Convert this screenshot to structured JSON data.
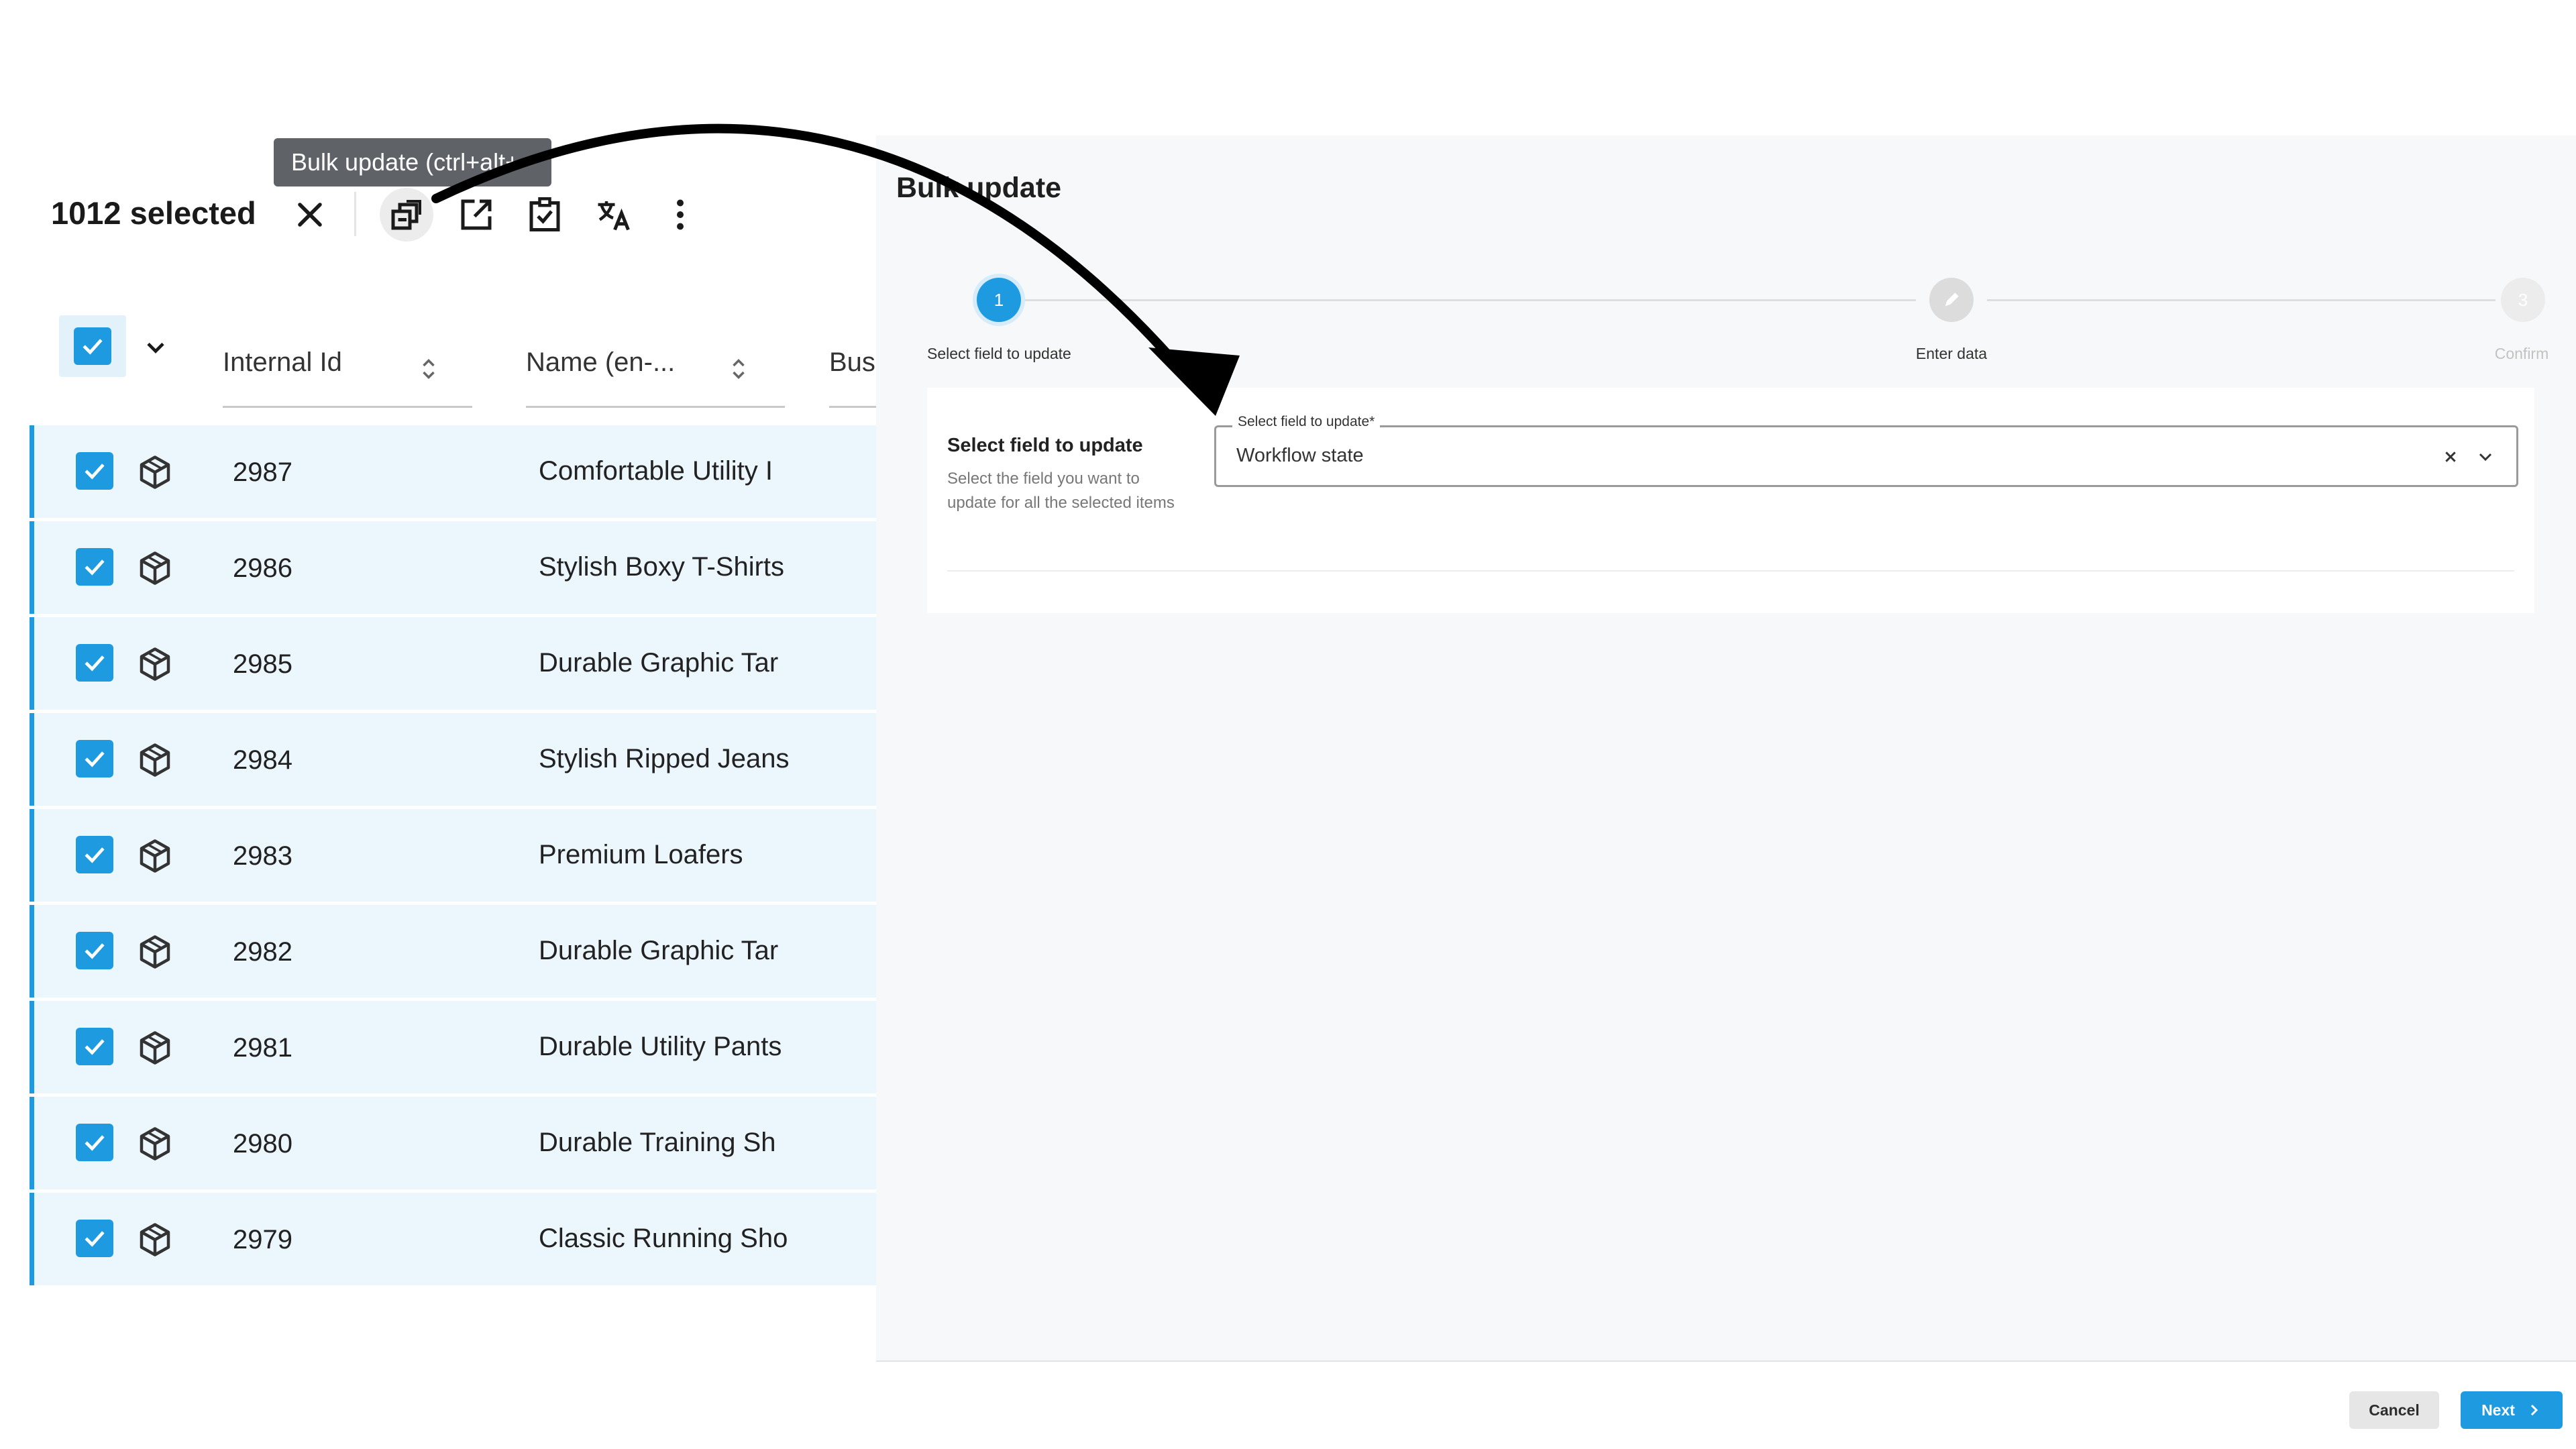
{
  "selection_toolbar": {
    "count_label": "1012 selected",
    "icons": [
      "close-icon",
      "bulk-update-icon",
      "export-icon",
      "checklist-icon",
      "translate-icon",
      "more-vertical-icon"
    ]
  },
  "tooltip": {
    "text": "Bulk update (ctrl+alt+"
  },
  "table": {
    "columns": [
      {
        "label": "Internal Id"
      },
      {
        "label": "Name (en-..."
      },
      {
        "label": "Bus"
      }
    ],
    "rows": [
      {
        "id": "2987",
        "name": "Comfortable Utility I"
      },
      {
        "id": "2986",
        "name": "Stylish Boxy T-Shirts"
      },
      {
        "id": "2985",
        "name": "Durable Graphic Tar"
      },
      {
        "id": "2984",
        "name": "Stylish Ripped Jeans"
      },
      {
        "id": "2983",
        "name": "Premium Loafers"
      },
      {
        "id": "2982",
        "name": "Durable Graphic Tar"
      },
      {
        "id": "2981",
        "name": "Durable Utility Pants"
      },
      {
        "id": "2980",
        "name": "Durable Training Sh"
      },
      {
        "id": "2979",
        "name": "Classic Running Sho"
      }
    ]
  },
  "bulk_update": {
    "title": "Bulk update",
    "steps": [
      {
        "number": "1",
        "label": "Select field to update",
        "state": "active"
      },
      {
        "number": "",
        "label": "Enter data",
        "state": "idle"
      },
      {
        "number": "3",
        "label": "Confirm",
        "state": "disabled"
      }
    ],
    "form": {
      "section_title": "Select field to update",
      "section_description": "Select the field you want to update for all the selected items",
      "field_label": "Select field to update*",
      "field_value": "Workflow state"
    },
    "footer": {
      "cancel_label": "Cancel",
      "next_label": "Next"
    }
  },
  "colors": {
    "accent": "#1e9ae0",
    "selected_row_bg": "#ecf6fd",
    "tooltip_bg": "#5f6368",
    "panel_bg": "#f7f8f9"
  }
}
